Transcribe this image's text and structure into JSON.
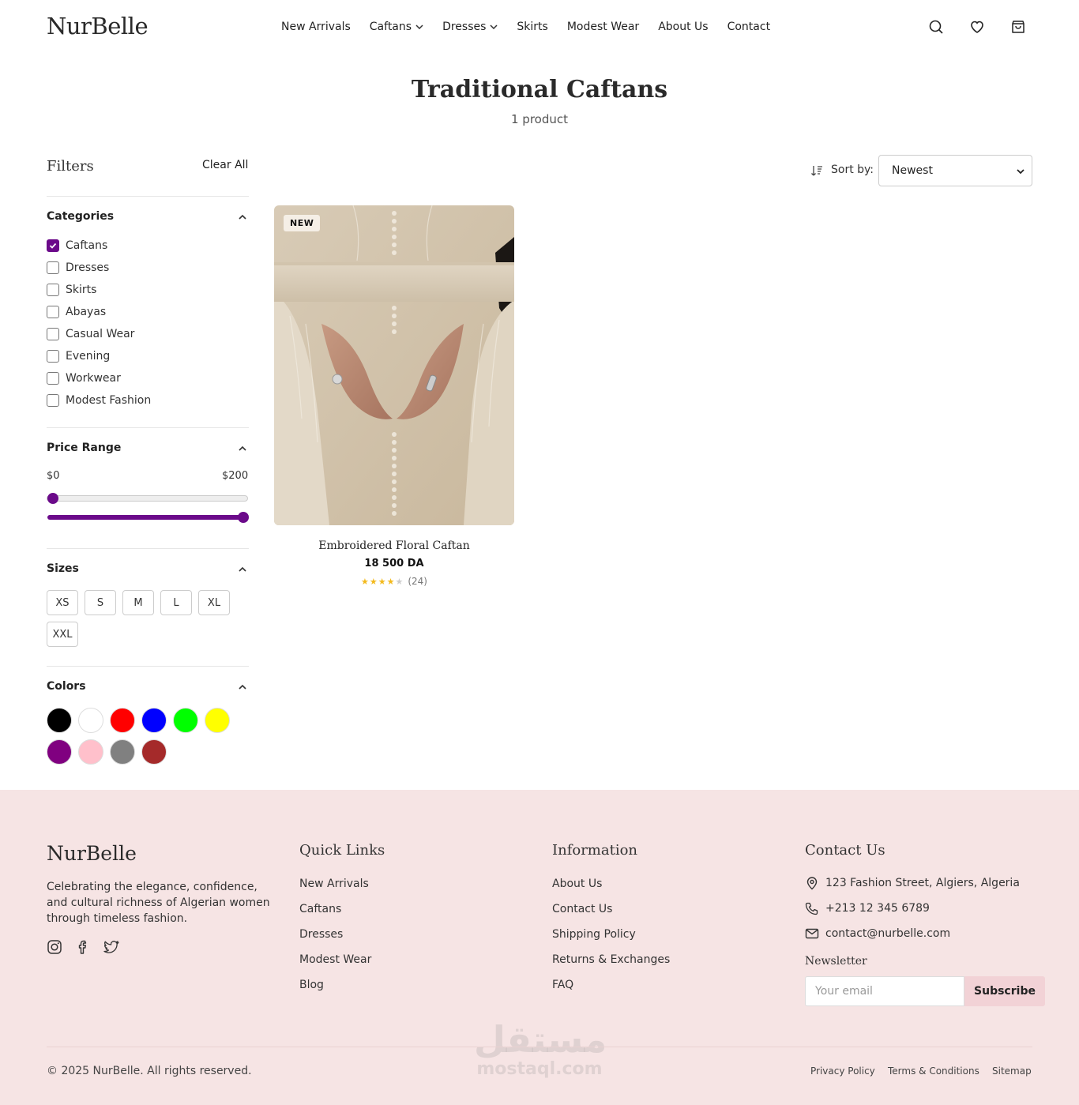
{
  "brand": {
    "logo": "NurBelle"
  },
  "nav": {
    "items": [
      {
        "label": "New Arrivals",
        "dropdown": false
      },
      {
        "label": "Caftans",
        "dropdown": true
      },
      {
        "label": "Dresses",
        "dropdown": true
      },
      {
        "label": "Skirts",
        "dropdown": false
      },
      {
        "label": "Modest Wear",
        "dropdown": false
      },
      {
        "label": "About Us",
        "dropdown": false
      },
      {
        "label": "Contact",
        "dropdown": false
      }
    ]
  },
  "header_icons": [
    "search-icon",
    "heart-icon",
    "shopping-bag-icon"
  ],
  "page": {
    "title": "Traditional Caftans",
    "count": "1 product"
  },
  "filters": {
    "title": "Filters",
    "clear_all": "Clear All",
    "categories": {
      "title": "Categories",
      "items": [
        {
          "label": "Caftans",
          "checked": true
        },
        {
          "label": "Dresses",
          "checked": false
        },
        {
          "label": "Skirts",
          "checked": false
        },
        {
          "label": "Abayas",
          "checked": false
        },
        {
          "label": "Casual Wear",
          "checked": false
        },
        {
          "label": "Evening",
          "checked": false
        },
        {
          "label": "Workwear",
          "checked": false
        },
        {
          "label": "Modest Fashion",
          "checked": false
        }
      ]
    },
    "price": {
      "title": "Price Range",
      "min_label": "$0",
      "max_label": "$200",
      "min": 0,
      "max": 200
    },
    "sizes": {
      "title": "Sizes",
      "items": [
        "XS",
        "S",
        "M",
        "L",
        "XL",
        "XXL"
      ]
    },
    "colors": {
      "title": "Colors",
      "items": [
        "#000000",
        "#ffffff",
        "#ff0000",
        "#0000ff",
        "#00ff00",
        "#ffff00",
        "#800080",
        "#ffc0cb",
        "#808080",
        "#a52a2a"
      ]
    }
  },
  "sort": {
    "label": "Sort by:",
    "selected": "Newest"
  },
  "products": [
    {
      "badge": "NEW",
      "name": "Embroidered Floral Caftan",
      "price": "18 500 DA",
      "rating": 4,
      "rating_max": 5,
      "reviews": "(24)"
    }
  ],
  "footer": {
    "logo": "NurBelle",
    "description": "Celebrating the elegance, confidence, and cultural richness of Algerian women through timeless fashion.",
    "social": [
      "instagram-icon",
      "facebook-icon",
      "twitter-icon"
    ],
    "quick_links": {
      "title": "Quick Links",
      "items": [
        "New Arrivals",
        "Caftans",
        "Dresses",
        "Modest Wear",
        "Blog"
      ]
    },
    "information": {
      "title": "Information",
      "items": [
        "About Us",
        "Contact Us",
        "Shipping Policy",
        "Returns & Exchanges",
        "FAQ"
      ]
    },
    "contact": {
      "title": "Contact Us",
      "address": "123 Fashion Street, Algiers, Algeria",
      "phone": "+213 12 345 6789",
      "email": "contact@nurbelle.com"
    },
    "newsletter": {
      "title": "Newsletter",
      "placeholder": "Your email",
      "button": "Subscribe"
    },
    "copyright": "© 2025 NurBelle. All rights reserved.",
    "legal": [
      "Privacy Policy",
      "Terms & Conditions",
      "Sitemap"
    ]
  },
  "watermark": {
    "arabic": "مستقل",
    "latin": "mostaql.com"
  },
  "colors": {
    "accent": "#6b0a8a",
    "footer_bg": "#f6e4e4",
    "subscribe_bg": "#f2d2d6"
  }
}
